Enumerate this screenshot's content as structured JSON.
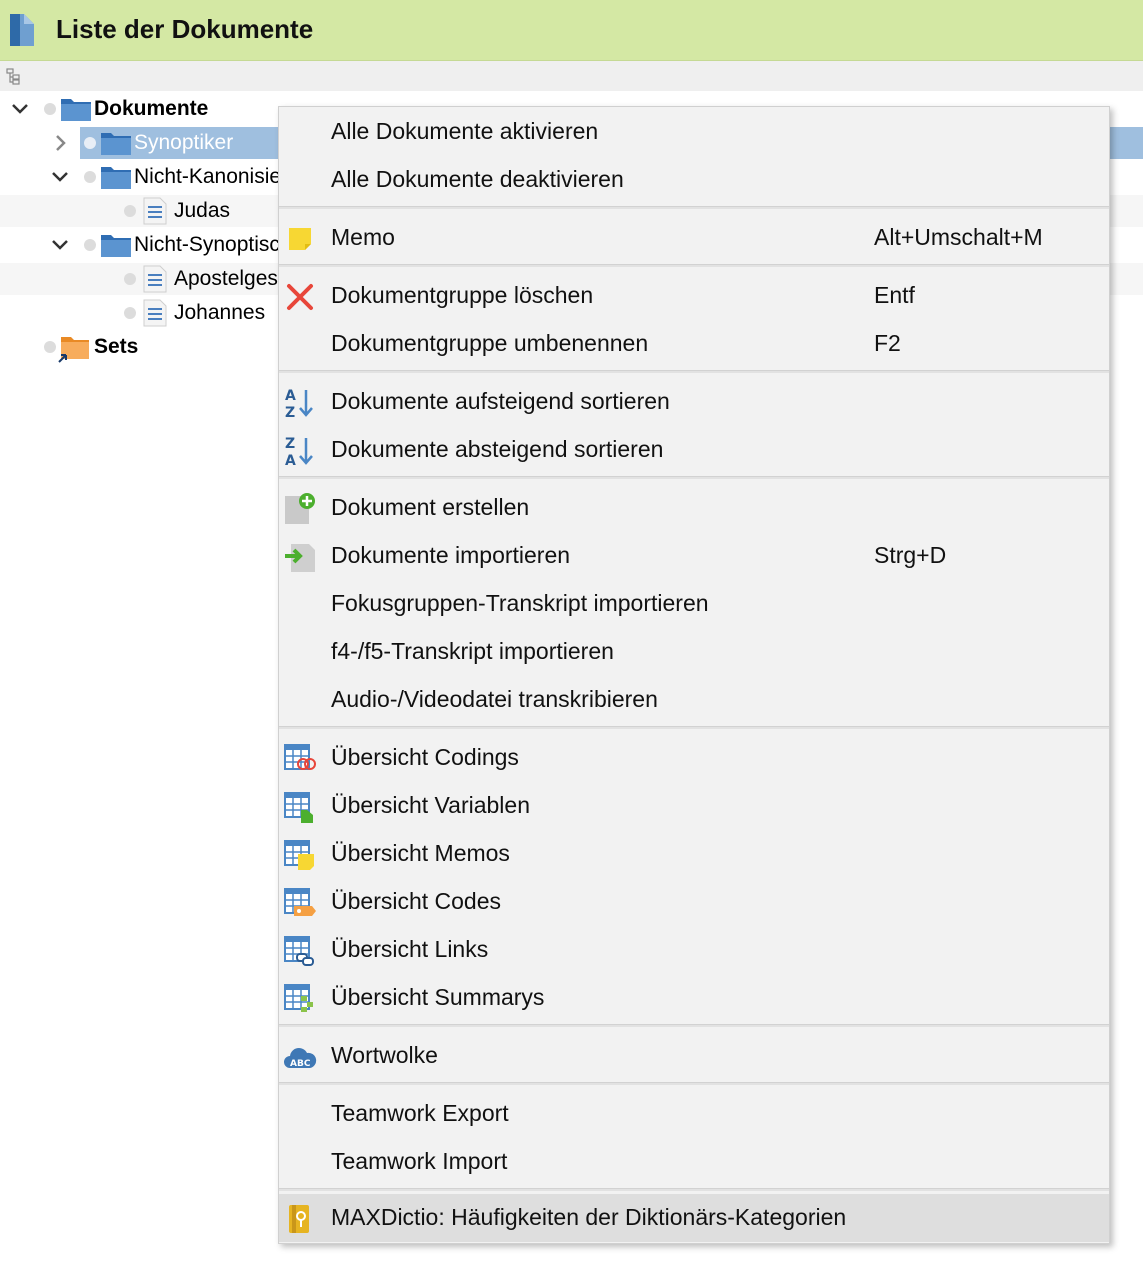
{
  "window": {
    "title": "Liste der Dokumente"
  },
  "tree": {
    "root": "Dokumente",
    "groups": [
      {
        "label": "Synoptiker"
      },
      {
        "label": "Nicht-Kanonisie"
      },
      {
        "label": "Nicht-Synoptisc"
      }
    ],
    "docs": [
      {
        "label": "Judas"
      },
      {
        "label": "Apostelges"
      },
      {
        "label": "Johannes"
      }
    ],
    "sets": "Sets"
  },
  "menu": {
    "items": [
      {
        "label": "Alle Dokumente aktivieren",
        "shortcut": "",
        "icon": "none"
      },
      {
        "label": "Alle Dokumente deaktivieren",
        "shortcut": "",
        "icon": "none"
      },
      {
        "label": "Memo",
        "shortcut": "Alt+Umschalt+M",
        "icon": "memo-icon"
      },
      {
        "label": "Dokumentgruppe löschen",
        "shortcut": "Entf",
        "icon": "delete-icon"
      },
      {
        "label": "Dokumentgruppe umbenennen",
        "shortcut": "F2",
        "icon": "none"
      },
      {
        "label": "Dokumente aufsteigend sortieren",
        "shortcut": "",
        "icon": "sort-ascending-icon"
      },
      {
        "label": "Dokumente absteigend sortieren",
        "shortcut": "",
        "icon": "sort-descending-icon"
      },
      {
        "label": "Dokument erstellen",
        "shortcut": "",
        "icon": "new-document-icon"
      },
      {
        "label": "Dokumente importieren",
        "shortcut": "Strg+D",
        "icon": "import-icon"
      },
      {
        "label": "Fokusgruppen-Transkript importieren",
        "shortcut": "",
        "icon": "none"
      },
      {
        "label": "f4-/f5-Transkript importieren",
        "shortcut": "",
        "icon": "none"
      },
      {
        "label": "Audio-/Videodatei transkribieren",
        "shortcut": "",
        "icon": "none"
      },
      {
        "label": "Übersicht Codings",
        "shortcut": "",
        "icon": "overview-codings-icon"
      },
      {
        "label": "Übersicht Variablen",
        "shortcut": "",
        "icon": "overview-variables-icon"
      },
      {
        "label": "Übersicht Memos",
        "shortcut": "",
        "icon": "overview-memos-icon"
      },
      {
        "label": "Übersicht Codes",
        "shortcut": "",
        "icon": "overview-codes-icon"
      },
      {
        "label": "Übersicht Links",
        "shortcut": "",
        "icon": "overview-links-icon"
      },
      {
        "label": "Übersicht Summarys",
        "shortcut": "",
        "icon": "overview-summaries-icon"
      },
      {
        "label": "Wortwolke",
        "shortcut": "",
        "icon": "word-cloud-icon"
      },
      {
        "label": "Teamwork Export",
        "shortcut": "",
        "icon": "none"
      },
      {
        "label": "Teamwork Import",
        "shortcut": "",
        "icon": "none"
      },
      {
        "label": "MAXDictio: Häufigkeiten der Diktionärs-Kategorien",
        "shortcut": "",
        "icon": "maxdictio-icon"
      }
    ],
    "highlighted_item": "MAXDictio: Häufigkeiten der Diktionärs-Kategorien"
  },
  "colors": {
    "title_bar": "#d4e8a4",
    "selection": "#9fbfdf",
    "folder": "#4a86c5",
    "sets_folder": "#f5a043",
    "delete_red": "#e8463a",
    "memo_yellow": "#f7d733",
    "menu_background": "#f2f2f2",
    "menu_highlight": "#dedede"
  }
}
